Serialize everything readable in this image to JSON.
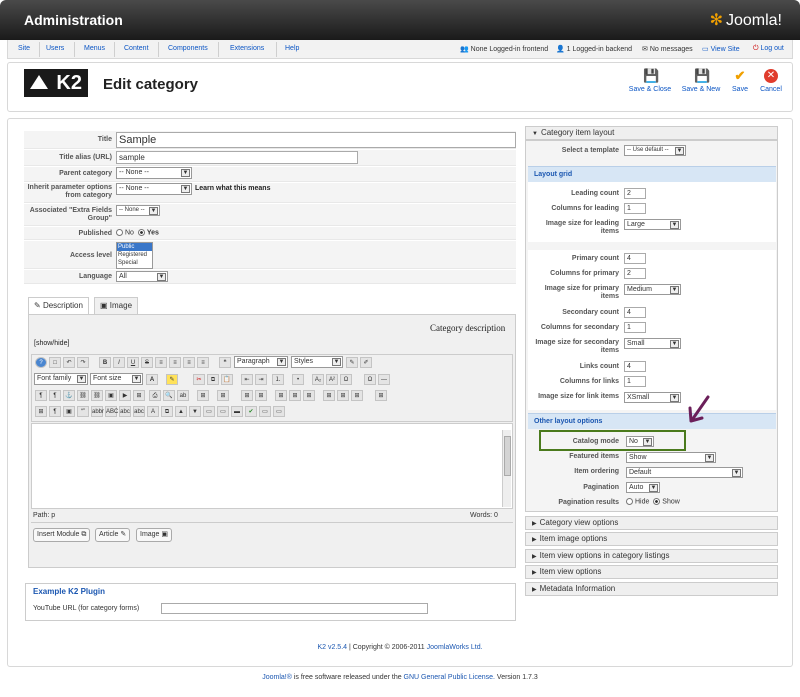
{
  "header": {
    "title": "Administration",
    "logo_text": "Joomla!"
  },
  "menu": [
    "Site",
    "Users",
    "Menus",
    "Content",
    "Components",
    "Extensions",
    "Help"
  ],
  "status": {
    "frontend": "None Logged-in frontend",
    "backend": "1 Logged-in backend",
    "messages": "No messages",
    "view_site": "View Site",
    "logout": "Log out"
  },
  "k2_logo": "K2",
  "page_title": "Edit category",
  "toolbar": {
    "save_close": "Save & Close",
    "save_new": "Save & New",
    "save": "Save",
    "cancel": "Cancel"
  },
  "form": {
    "title_label": "Title",
    "title_value": "Sample",
    "alias_label": "Title alias (URL)",
    "alias_value": "sample",
    "parent_label": "Parent category",
    "parent_value": "-- None --",
    "inherit_label": "Inherit parameter options from category",
    "inherit_value": "-- None --",
    "learn_link": "Learn what this means",
    "extra_label": "Associated \"Extra Fields Group\"",
    "extra_value": "-- None --",
    "published_label": "Published",
    "no": "No",
    "yes": "Yes",
    "access_label": "Access level",
    "access_options": [
      "Public",
      "Registered",
      "Special"
    ],
    "language_label": "Language",
    "language_value": "All"
  },
  "tabs": {
    "description": "Description",
    "image": "Image"
  },
  "editor": {
    "heading": "Category description",
    "showhide": "[show/hide]",
    "paragraph": "Paragraph",
    "styles": "Styles",
    "font_family": "Font family",
    "font_size": "Font size",
    "path": "Path:  p",
    "words": "Words: 0",
    "insert_module": "Insert Module",
    "article": "Article",
    "image": "Image"
  },
  "plugin": {
    "title": "Example K2 Plugin",
    "youtube_label": "YouTube URL (for category forms)"
  },
  "footer": {
    "version": "K2 v2.5.4",
    "copyright": " | Copyright © 2006-2011 ",
    "company": "JoomlaWorks Ltd."
  },
  "bottom": {
    "joomla": "Joomla!®",
    "text1": " is free software released under the ",
    "license": "GNU General Public License.",
    "version": "  Version 1.7.3"
  },
  "right": {
    "layout_head": "Category item layout",
    "template_label": "Select a template",
    "template_value": "-- Use default --",
    "grid_band": "Layout grid",
    "leading_count_label": "Leading count",
    "leading_count": "2",
    "col_leading_label": "Columns for leading",
    "col_leading": "1",
    "img_leading_label": "Image size for leading items",
    "img_leading": "Large",
    "primary_count_label": "Primary count",
    "primary_count": "4",
    "col_primary_label": "Columns for primary",
    "col_primary": "2",
    "img_primary_label": "Image size for primary items",
    "img_primary": "Medium",
    "secondary_count_label": "Secondary count",
    "secondary_count": "4",
    "col_secondary_label": "Columns for secondary",
    "col_secondary": "1",
    "img_secondary_label": "Image size for secondary items",
    "img_secondary": "Small",
    "links_count_label": "Links count",
    "links_count": "4",
    "col_links_label": "Columns for links",
    "col_links": "1",
    "img_links_label": "Image size for link items",
    "img_links": "XSmall",
    "other_band": "Other layout options",
    "catalog_label": "Catalog mode",
    "catalog_value": "No",
    "featured_label": "Featured items",
    "featured_value": "Show",
    "ordering_label": "Item ordering",
    "ordering_value": "Default",
    "pagination_label": "Pagination",
    "pagination_value": "Auto",
    "pagres_label": "Pagination results",
    "hide": "Hide",
    "show": "Show",
    "sections": [
      "Category view options",
      "Item image options",
      "Item view options in category listings",
      "Item view options",
      "Metadata Information"
    ]
  },
  "colors": {
    "highlight_box": "#4a7a1c",
    "arrow": "#6b1f5a",
    "link": "#1b57b1"
  }
}
